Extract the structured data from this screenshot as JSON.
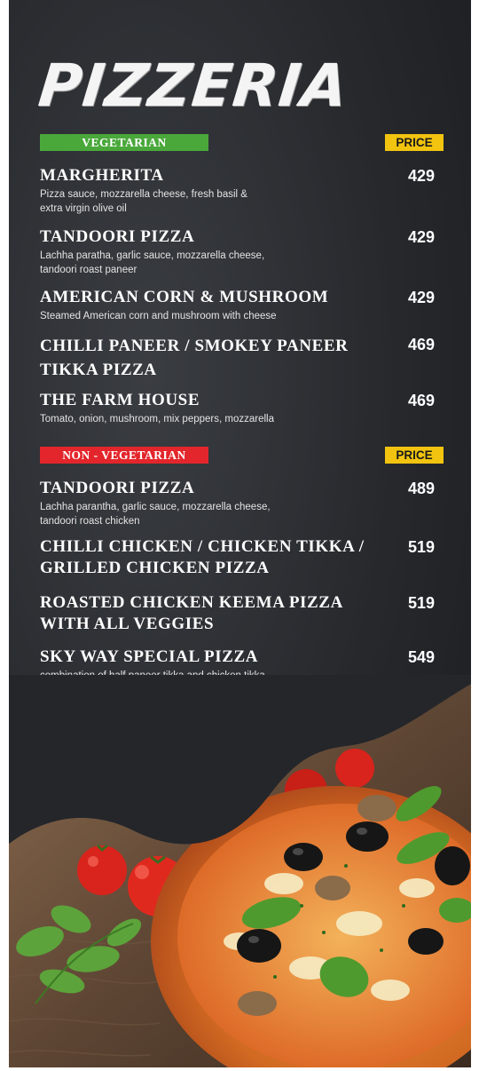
{
  "title": "PIZZERIA",
  "vegetarian": {
    "label": "VEGETARIAN",
    "price_header": "PRICE",
    "items": [
      {
        "name": "MARGHERITA",
        "desc": [
          "Pizza sauce, mozzarella cheese, fresh basil &",
          "extra virgin olive oil"
        ],
        "price": "429"
      },
      {
        "name": "TANDOORI PIZZA",
        "desc": [
          "Lachha paratha, garlic sauce, mozzarella cheese,",
          "tandoori roast paneer"
        ],
        "price": "429"
      },
      {
        "name": "AMERICAN CORN & MUSHROOM",
        "desc": [
          "Steamed American corn and mushroom with cheese"
        ],
        "price": "429"
      },
      {
        "name": [
          "CHILLI PANEER / SMOKEY PANEER",
          "TIKKA PIZZA"
        ],
        "price": "469"
      },
      {
        "name": "THE FARM HOUSE",
        "desc": [
          "Tomato, onion, mushroom, mix peppers, mozzarella"
        ],
        "price": "469"
      }
    ]
  },
  "non_vegetarian": {
    "label": "NON - VEGETARIAN",
    "price_header": "PRICE",
    "items": [
      {
        "name": "TANDOORI PIZZA",
        "desc": [
          "Lachha parantha, garlic sauce, mozzarella cheese,",
          "tandoori roast chicken"
        ],
        "price": "489"
      },
      {
        "name": [
          "CHILLI CHICKEN / CHICKEN TIKKA /",
          "GRILLED CHICKEN PIZZA"
        ],
        "price": "519"
      },
      {
        "name": [
          "ROASTED CHICKEN KEEMA PIZZA",
          "WITH ALL VEGGIES"
        ],
        "price": "519"
      },
      {
        "name": "SKY WAY SPECIAL PIZZA",
        "desc": [
          "combination of half paneer tikka and chicken tikka"
        ],
        "price": "549"
      }
    ]
  },
  "colors": {
    "background": "#26282c",
    "veg_green": "#4aa83b",
    "nonveg_red": "#e3262b",
    "price_yellow": "#f2c40f",
    "text": "#ffffff"
  },
  "icons": [
    "pizza-photo",
    "tomato-icon",
    "coriander-leaf-icon"
  ]
}
